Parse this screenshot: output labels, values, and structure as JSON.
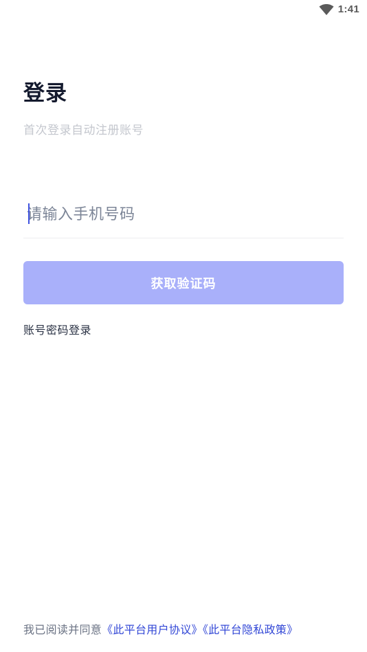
{
  "status_bar": {
    "time": "1:41",
    "wifi_icon": "wifi-icon"
  },
  "login": {
    "title": "登录",
    "subtitle": "首次登录自动注册账号",
    "phone_placeholder": "请输入手机号码",
    "phone_value": "",
    "get_code_label": "获取验证码",
    "password_login_label": "账号密码登录"
  },
  "agreement": {
    "prefix": "我已阅读并同意",
    "user_agreement": "《此平台用户协议》",
    "privacy_policy": "《此平台隐私政策》"
  },
  "colors": {
    "primary_button_disabled": "#a9b0fa",
    "link": "#3247d6",
    "title": "#141a2e",
    "subtitle": "#c4c7ce",
    "cursor": "#3f53e0"
  }
}
